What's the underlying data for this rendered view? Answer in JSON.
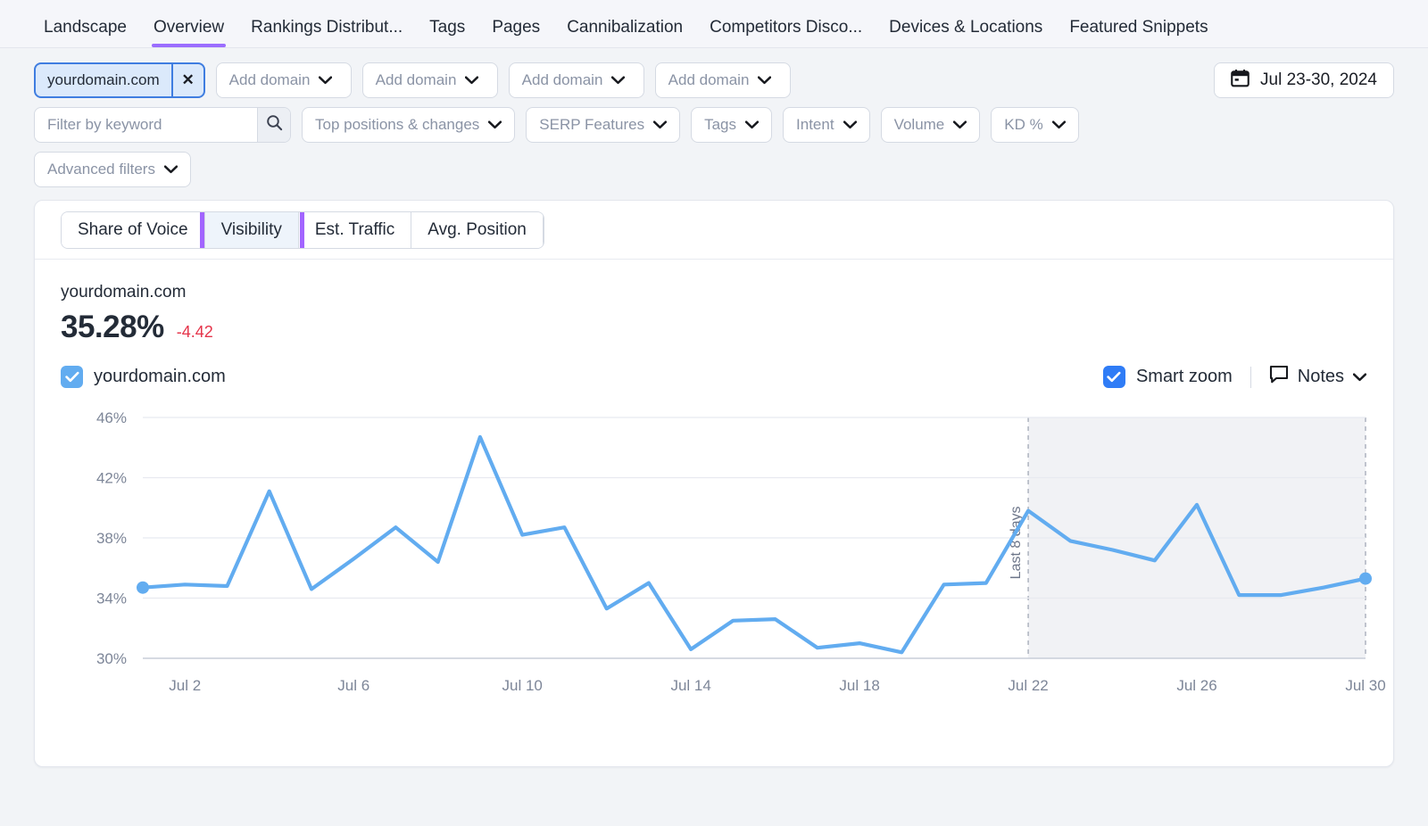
{
  "nav": {
    "tabs": [
      {
        "label": "Landscape",
        "active": false
      },
      {
        "label": "Overview",
        "active": true
      },
      {
        "label": "Rankings Distribut...",
        "active": false
      },
      {
        "label": "Tags",
        "active": false
      },
      {
        "label": "Pages",
        "active": false
      },
      {
        "label": "Cannibalization",
        "active": false
      },
      {
        "label": "Competitors Disco...",
        "active": false
      },
      {
        "label": "Devices & Locations",
        "active": false
      },
      {
        "label": "Featured Snippets",
        "active": false
      }
    ]
  },
  "filters": {
    "domain_chip": {
      "label": "yourdomain.com",
      "close_label": "✕"
    },
    "add_domain_label": "Add domain",
    "add_domain_count": 4,
    "search": {
      "placeholder": "Filter by keyword",
      "value": ""
    },
    "dropdowns": [
      "Top positions & changes",
      "SERP Features",
      "Tags",
      "Intent",
      "Volume",
      "KD %"
    ],
    "advanced_filters": "Advanced filters",
    "date_range": "Jul 23-30, 2024",
    "chevron": "⌄"
  },
  "card": {
    "tabs": [
      {
        "label": "Share of Voice",
        "selected": false
      },
      {
        "label": "Visibility",
        "selected": true
      },
      {
        "label": "Est. Traffic",
        "selected": false
      },
      {
        "label": "Avg. Position",
        "selected": false
      }
    ],
    "highlight_tab": "Visibility",
    "highlight_color": "#a265ff",
    "metric": {
      "domain": "yourdomain.com",
      "value": "35.28%",
      "delta": "-4.42",
      "delta_color": "#e5344a"
    },
    "legend": {
      "series_label": "yourdomain.com",
      "series_color": "#62acf0",
      "series_checked": true,
      "smart_zoom_label": "Smart zoom",
      "smart_zoom_checked": true,
      "smart_zoom_color": "#2f7cf6",
      "notes_label": "Notes"
    }
  },
  "chart_data": {
    "type": "line",
    "title": "",
    "xlabel": "",
    "ylabel": "",
    "ylim": [
      30,
      46
    ],
    "yticks": [
      "30%",
      "34%",
      "38%",
      "42%",
      "46%"
    ],
    "ytick_values": [
      30,
      34,
      38,
      42,
      46
    ],
    "xticks": [
      "Jul 2",
      "Jul 6",
      "Jul 10",
      "Jul 14",
      "Jul 18",
      "Jul 22",
      "Jul 26",
      "Jul 30"
    ],
    "xtick_values": [
      2,
      6,
      10,
      14,
      18,
      22,
      26,
      30
    ],
    "grid": true,
    "legend_position": "top-left",
    "series": [
      {
        "name": "yourdomain.com",
        "color": "#62acf0",
        "x": [
          1,
          2,
          3,
          4,
          5,
          6,
          7,
          8,
          9,
          10,
          11,
          12,
          13,
          14,
          15,
          16,
          17,
          18,
          19,
          20,
          21,
          22,
          23,
          24,
          25,
          26,
          27,
          28,
          29,
          30
        ],
        "x_labels": [
          "Jul 1",
          "Jul 2",
          "Jul 3",
          "Jul 4",
          "Jul 5",
          "Jul 6",
          "Jul 7",
          "Jul 8",
          "Jul 9",
          "Jul 10",
          "Jul 11",
          "Jul 12",
          "Jul 13",
          "Jul 14",
          "Jul 15",
          "Jul 16",
          "Jul 17",
          "Jul 18",
          "Jul 19",
          "Jul 20",
          "Jul 21",
          "Jul 22",
          "Jul 23",
          "Jul 24",
          "Jul 25",
          "Jul 26",
          "Jul 27",
          "Jul 28",
          "Jul 29",
          "Jul 30"
        ],
        "values": [
          34.7,
          34.9,
          34.8,
          41.1,
          34.6,
          36.6,
          38.7,
          36.4,
          44.7,
          38.2,
          38.7,
          33.3,
          35.0,
          30.6,
          32.5,
          32.6,
          30.7,
          31.0,
          30.4,
          34.9,
          35.0,
          39.8,
          37.8,
          37.2,
          36.5,
          40.2,
          34.2,
          34.2,
          34.7,
          35.3
        ]
      }
    ],
    "annotations": [
      {
        "type": "shaded-band",
        "label": "Last 8 days",
        "start_x": 22,
        "end_x": 30,
        "fill": "#f1f2f5",
        "border": "dashed"
      }
    ]
  }
}
